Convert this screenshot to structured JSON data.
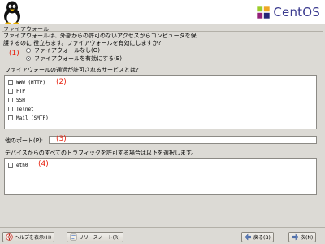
{
  "header": {
    "brand": "CentOS"
  },
  "section": {
    "title": "ファイアウォール"
  },
  "intro": {
    "line1": "ファイアウォールは、外部からの許可のないアクセスからコンピュータを保",
    "line2": "護するのに 役立ちます。ファイアウォールを有効にしますか?"
  },
  "markers": [
    "(1)",
    "(2)",
    "(3)",
    "(4)"
  ],
  "firewall_options": [
    {
      "label": "ファイアウォールなし(O)",
      "selected": false
    },
    {
      "label": "ファイアウォールを有効にする(E)",
      "selected": true
    }
  ],
  "services": {
    "heading": "ファイアウォールの通過が許可されるサービスとは?",
    "items": [
      "WWW (HTTP)",
      "FTP",
      "SSH",
      "Telnet",
      "Mail (SMTP)"
    ]
  },
  "other_ports": {
    "label": "他のポート(P):",
    "value": ""
  },
  "trusted": {
    "heading": "デバイスからのすべてのトラフィックを許可する場合は以下を選択します。",
    "devices": [
      "eth0"
    ]
  },
  "buttons": {
    "help": "ヘルプを表示(H)",
    "release_notes": "リリースノート(R)",
    "back": "戻る(B)",
    "next": "次(N)"
  }
}
